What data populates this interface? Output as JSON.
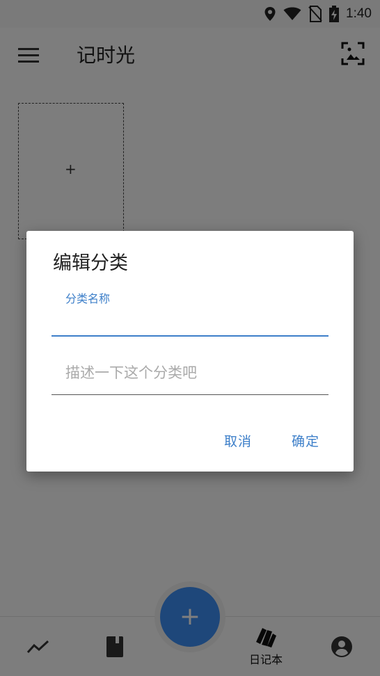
{
  "status_bar": {
    "time": "1:40"
  },
  "app_bar": {
    "title": "记时光",
    "menu_icon": "menu-icon",
    "action_icon": "image-frame-icon"
  },
  "content": {
    "add_card_symbol": "+"
  },
  "bottom_nav": {
    "fab_label": "+",
    "items": [
      {
        "icon": "trend-icon",
        "label": ""
      },
      {
        "icon": "book-icon",
        "label": ""
      },
      {
        "icon": "notebook-cards-icon",
        "label": "日记本",
        "active": true
      },
      {
        "icon": "account-icon",
        "label": ""
      }
    ]
  },
  "dialog": {
    "title": "编辑分类",
    "name_label": "分类名称",
    "name_value": "",
    "description_placeholder": "描述一下这个分类吧",
    "cancel_label": "取消",
    "confirm_label": "确定"
  },
  "colors": {
    "accent": "#3d7fc9",
    "fab": "#3d8ff5",
    "scrim": "rgba(0,0,0,0.5)"
  }
}
